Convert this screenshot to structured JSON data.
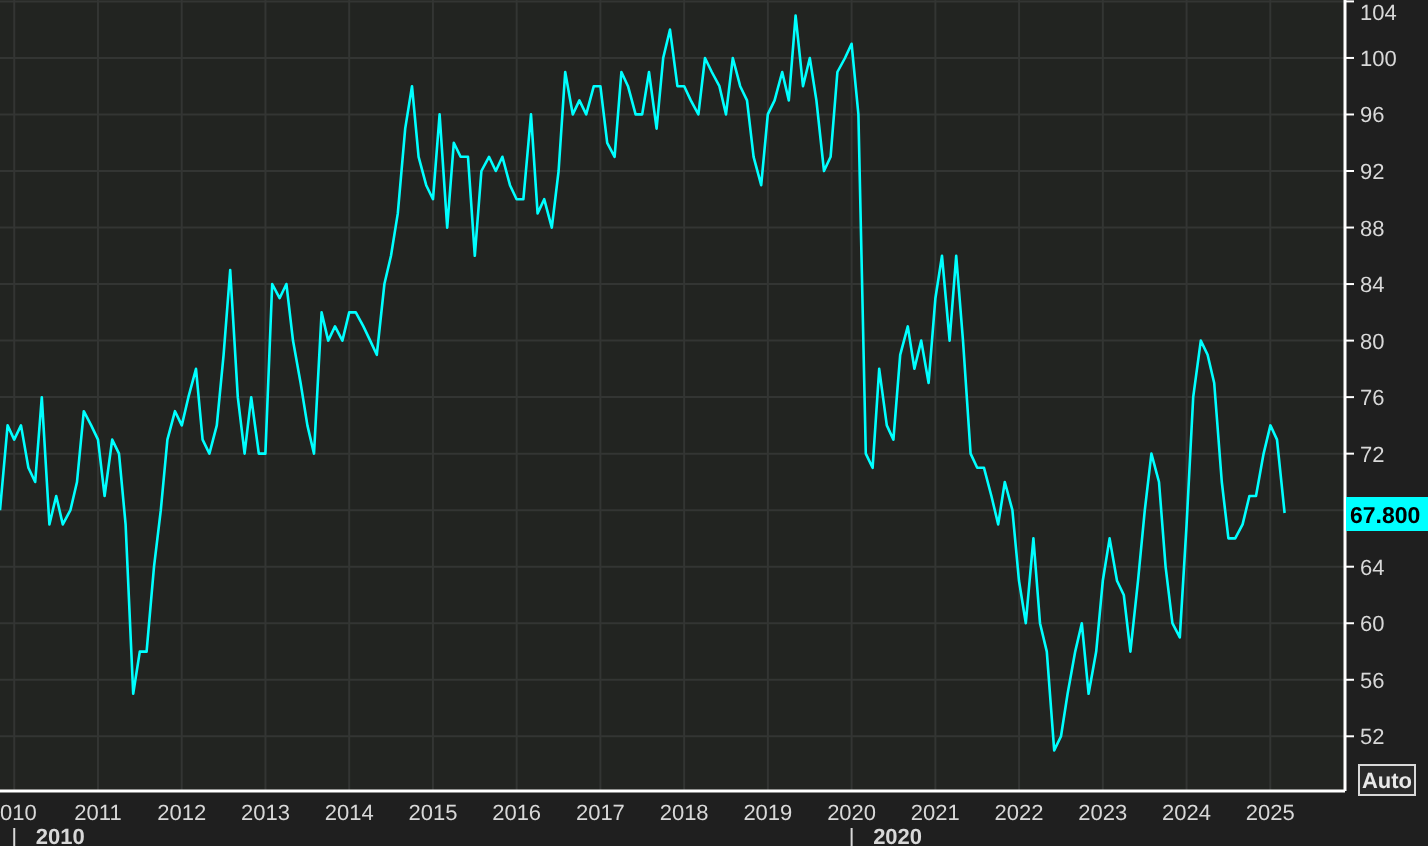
{
  "chart": {
    "chart_data": {
      "type": "line",
      "grid": true,
      "xlim": [
        2009.83,
        2025.88
      ],
      "ylim": [
        48.2,
        104.1
      ],
      "yticks": [
        52,
        56,
        60,
        64,
        72,
        76,
        80,
        84,
        88,
        92,
        96,
        100,
        104
      ],
      "xticks": [
        2011,
        2012,
        2013,
        2014,
        2015,
        2016,
        2017,
        2018,
        2019,
        2020,
        2021,
        2022,
        2023,
        2024,
        2025
      ],
      "x": [
        2009.83,
        2009.92,
        2010,
        2010.08,
        2010.17,
        2010.25,
        2010.33,
        2010.42,
        2010.5,
        2010.58,
        2010.67,
        2010.75,
        2010.83,
        2010.92,
        2011,
        2011.08,
        2011.17,
        2011.25,
        2011.33,
        2011.42,
        2011.5,
        2011.58,
        2011.67,
        2011.75,
        2011.83,
        2011.92,
        2012,
        2012.08,
        2012.17,
        2012.25,
        2012.33,
        2012.42,
        2012.5,
        2012.58,
        2012.67,
        2012.75,
        2012.83,
        2012.92,
        2013,
        2013.08,
        2013.17,
        2013.25,
        2013.33,
        2013.42,
        2013.5,
        2013.58,
        2013.67,
        2013.75,
        2013.83,
        2013.92,
        2014,
        2014.08,
        2014.17,
        2014.25,
        2014.33,
        2014.42,
        2014.5,
        2014.58,
        2014.67,
        2014.75,
        2014.83,
        2014.92,
        2015,
        2015.08,
        2015.17,
        2015.25,
        2015.33,
        2015.42,
        2015.5,
        2015.58,
        2015.67,
        2015.75,
        2015.83,
        2015.92,
        2016,
        2016.08,
        2016.17,
        2016.25,
        2016.33,
        2016.42,
        2016.5,
        2016.58,
        2016.67,
        2016.75,
        2016.83,
        2016.92,
        2017,
        2017.08,
        2017.17,
        2017.25,
        2017.33,
        2017.42,
        2017.5,
        2017.58,
        2017.67,
        2017.75,
        2017.83,
        2017.92,
        2018,
        2018.08,
        2018.17,
        2018.25,
        2018.33,
        2018.42,
        2018.5,
        2018.58,
        2018.67,
        2018.75,
        2018.83,
        2018.92,
        2019,
        2019.08,
        2019.17,
        2019.25,
        2019.33,
        2019.42,
        2019.5,
        2019.58,
        2019.67,
        2019.75,
        2019.83,
        2019.92,
        2020,
        2020.08,
        2020.17,
        2020.25,
        2020.33,
        2020.42,
        2020.5,
        2020.58,
        2020.67,
        2020.75,
        2020.83,
        2020.92,
        2021,
        2021.08,
        2021.17,
        2021.25,
        2021.33,
        2021.42,
        2021.5,
        2021.58,
        2021.67,
        2021.75,
        2021.83,
        2021.92,
        2022,
        2022.08,
        2022.17,
        2022.25,
        2022.33,
        2022.42,
        2022.5,
        2022.58,
        2022.67,
        2022.75,
        2022.83,
        2022.92,
        2023,
        2023.08,
        2023.17,
        2023.25,
        2023.33,
        2023.42,
        2023.5,
        2023.58,
        2023.67,
        2023.75,
        2023.83,
        2023.92,
        2024,
        2024.08,
        2024.17,
        2024.25,
        2024.33,
        2024.42,
        2024.5,
        2024.58,
        2024.67,
        2024.75,
        2024.83,
        2024.92,
        2025,
        2025.08,
        2025.17
      ],
      "series": [
        {
          "color": "#00ffff",
          "values": [
            68,
            74,
            73,
            74,
            71,
            70,
            76,
            67,
            69,
            67,
            68,
            70,
            75,
            74,
            73,
            69,
            73,
            72,
            67,
            55,
            58,
            58,
            64,
            68,
            73,
            75,
            74,
            76,
            78,
            73,
            72,
            74,
            79,
            85,
            76,
            72,
            76,
            72,
            72,
            84,
            83,
            84,
            80,
            77,
            74,
            72,
            82,
            80,
            81,
            80,
            82,
            82,
            81,
            80,
            79,
            84,
            86,
            89,
            95,
            98,
            93,
            91,
            90,
            96,
            88,
            94,
            93,
            93,
            86,
            92,
            93,
            92,
            93,
            91,
            90,
            90,
            96,
            89,
            90,
            88,
            92,
            99,
            96,
            97,
            96,
            98,
            98,
            94,
            93,
            99,
            98,
            96,
            96,
            99,
            95,
            100,
            102,
            98,
            98,
            97,
            96,
            100,
            99,
            98,
            96,
            100,
            98,
            97,
            93,
            91,
            96,
            97,
            99,
            97,
            103,
            98,
            100,
            97,
            92,
            93,
            99,
            100,
            101,
            96,
            72,
            71,
            78,
            74,
            73,
            79,
            81,
            78,
            80,
            77,
            83,
            86,
            80,
            86,
            80,
            72,
            71,
            71,
            69,
            67,
            70,
            68,
            63,
            60,
            66,
            60,
            58,
            51,
            52,
            55,
            58,
            60,
            55,
            58,
            63,
            66,
            63,
            62,
            58,
            63,
            68,
            72,
            70,
            64,
            60,
            59,
            67,
            76,
            80,
            79,
            77,
            70,
            66,
            66,
            67,
            69,
            69,
            72,
            74,
            73,
            67.8
          ]
        }
      ]
    },
    "last_value_label": "67.800",
    "cut_year_label": "010",
    "decade_labels": [
      "2010",
      "2020"
    ],
    "auto_button": "Auto"
  }
}
